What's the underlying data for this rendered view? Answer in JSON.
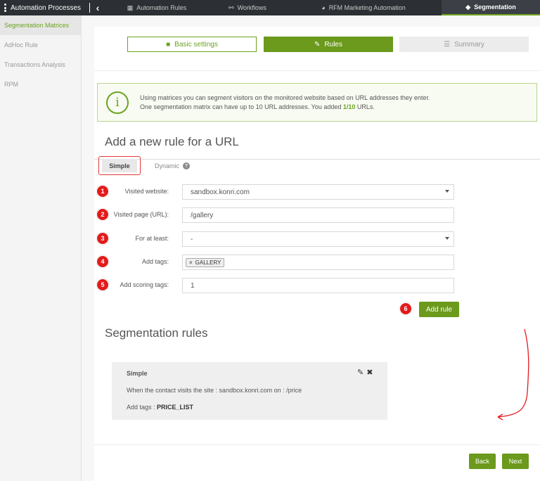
{
  "topbar": {
    "app_title": "Automation Processes",
    "tabs": [
      {
        "label": "Automation Rules",
        "icon": "grid-icon"
      },
      {
        "label": "Workflows",
        "icon": "sitemap-icon"
      },
      {
        "label": "RFM Marketing Automation",
        "icon": "pie-icon"
      },
      {
        "label": "Segmentation",
        "icon": "tag-icon"
      }
    ]
  },
  "sidebar": {
    "items": [
      {
        "label": "Segmentation Matrices"
      },
      {
        "label": "AdHoc Rule"
      },
      {
        "label": "Transactions Analysis"
      },
      {
        "label": "RPM"
      }
    ]
  },
  "wizard": {
    "step1": "Basic settings",
    "step2": "Rules",
    "step3": "Summary"
  },
  "info": {
    "line1": "Using matrices you can segment visitors on the monitored website based on URL addresses they enter.",
    "line2_pre": "One segmentation matrix can have up to 10 URL addresses. You added ",
    "line2_count": "1/10",
    "line2_post": " URLs."
  },
  "form": {
    "heading": "Add a new rule for a URL",
    "tab_simple": "Simple",
    "tab_dynamic": "Dynamic",
    "rows": [
      {
        "num": "1",
        "label": "Visited website:",
        "value": "sandbox.konri.com"
      },
      {
        "num": "2",
        "label": "Visited page (URL):",
        "value": "/gallery"
      },
      {
        "num": "3",
        "label": "For at least:",
        "value": "-"
      },
      {
        "num": "4",
        "label": "Add tags:",
        "tag": "GALLERY"
      },
      {
        "num": "5",
        "label": "Add scoring tags:",
        "value": "1"
      }
    ],
    "add_num": "6",
    "add_label": "Add rule"
  },
  "rules": {
    "heading": "Segmentation rules",
    "items": [
      {
        "type": "Simple",
        "desc": "When the contact visits the site : sandbox.konri.com on : /price",
        "tags_label": "Add tags : ",
        "tags_value": "PRICE_LIST"
      }
    ]
  },
  "footer": {
    "back": "Back",
    "next": "Next"
  },
  "colors": {
    "accent": "#6b9a1c",
    "badge": "#e31b1b",
    "topbar": "#2c2f33"
  }
}
